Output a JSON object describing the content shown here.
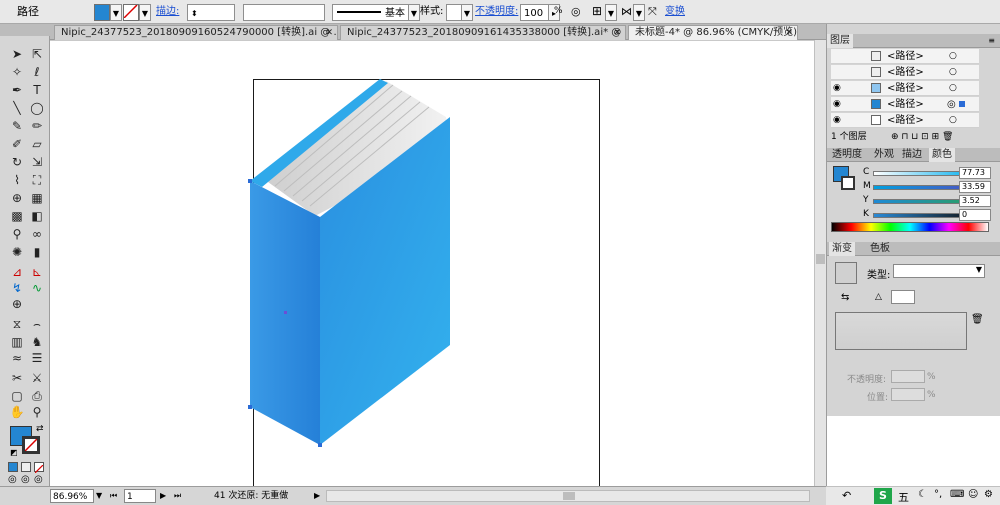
{
  "control_bar": {
    "object_type": "路径",
    "stroke_label": "描边:",
    "stroke_style_label": "基本",
    "style_label": "样式:",
    "opacity_label": "不透明度:",
    "opacity_value": "100",
    "opacity_unit": "%",
    "transform_label": "变换",
    "fill_color": "#2486d1"
  },
  "tabs": [
    {
      "label": "Nipic_24377523_20180909160524790000 [转换].ai @ ..."
    },
    {
      "label": "Nipic_24377523_20180909161435338000 [转换].ai* @ ..."
    },
    {
      "label": "未标题-4* @ 86.96% (CMYK/预览)"
    }
  ],
  "layers_panel": {
    "title": "图层",
    "rows": [
      {
        "label": "<路径>"
      },
      {
        "label": "<路径>"
      },
      {
        "label": "<路径>"
      },
      {
        "label": "<路径>"
      },
      {
        "label": "<路径>"
      }
    ],
    "footer": "1 个图层"
  },
  "color_panel": {
    "tabs": [
      "透明度",
      "外观",
      "描边",
      "颜色"
    ],
    "sliders": [
      {
        "channel": "C",
        "value": "77.73"
      },
      {
        "channel": "M",
        "value": "33.59"
      },
      {
        "channel": "Y",
        "value": "3.52"
      },
      {
        "channel": "K",
        "value": "0"
      }
    ]
  },
  "gradient_panel": {
    "tabs": [
      "渐变",
      "色板"
    ],
    "type_label": "类型:",
    "opacity_label": "不透明度:",
    "position_label": "位置:",
    "unit": "%"
  },
  "status_bar": {
    "zoom": "86.96%",
    "page": "1",
    "undo_text": "41 次还原: 无重做"
  },
  "tray": {
    "ime_label": "五"
  }
}
